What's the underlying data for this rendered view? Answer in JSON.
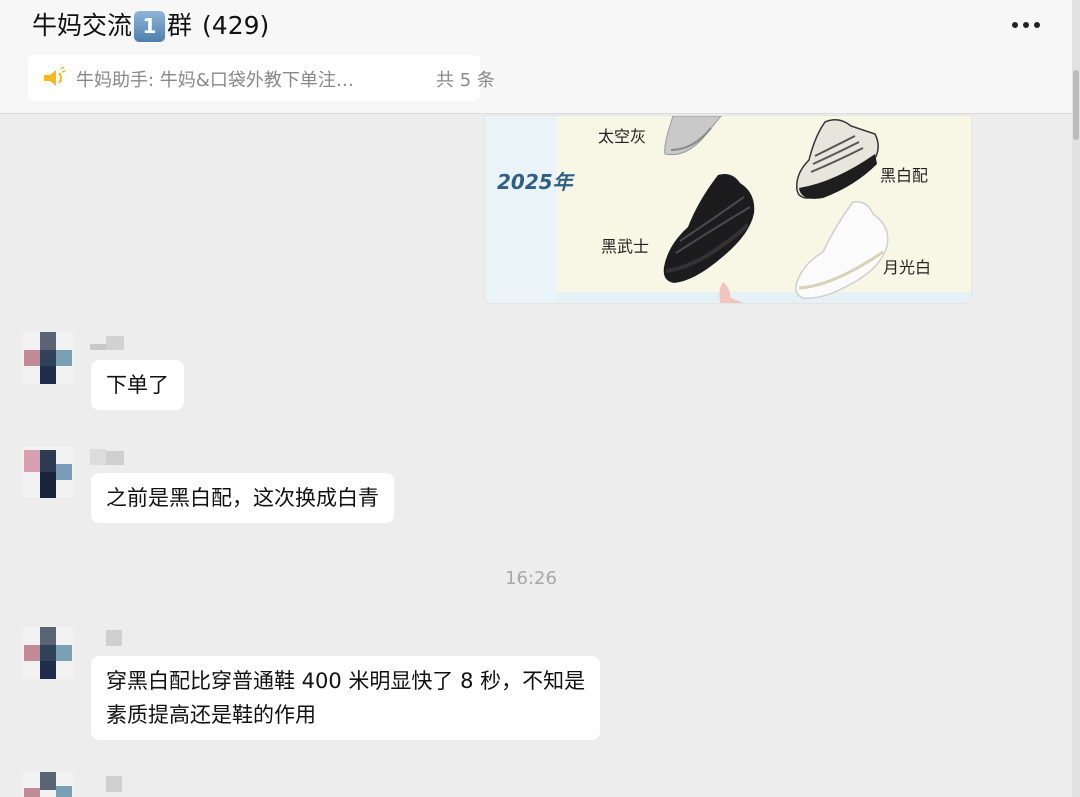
{
  "header": {
    "title_prefix": "牛妈交流",
    "title_badge": "1",
    "title_suffix": "群",
    "member_count": "(429)",
    "more_icon": "more-dots-icon"
  },
  "pinned": {
    "icon": "speaker-icon",
    "text": "牛妈助手: 牛妈&口袋外教下单注…",
    "count": "共 5 条"
  },
  "image_message": {
    "year": "2025年",
    "labels": {
      "space_gray": "太空灰",
      "black_white": "黑白配",
      "black_warrior": "黑武士",
      "moonlight_white": "月光白"
    }
  },
  "messages": [
    {
      "text_lines": [
        "下单了"
      ]
    },
    {
      "text_lines": [
        "之前是黑白配，这次换成白青"
      ]
    },
    {
      "text_lines": [
        "穿黑白配比穿普通鞋 400 米明显快了 8 秒，不知是",
        "素质提高还是鞋的作用"
      ]
    }
  ],
  "timestamp": "16:26",
  "colors": {
    "background": "#ededed",
    "bubble": "#ffffff",
    "header": "#f7f7f7",
    "timestamp": "#a8a8a8"
  }
}
